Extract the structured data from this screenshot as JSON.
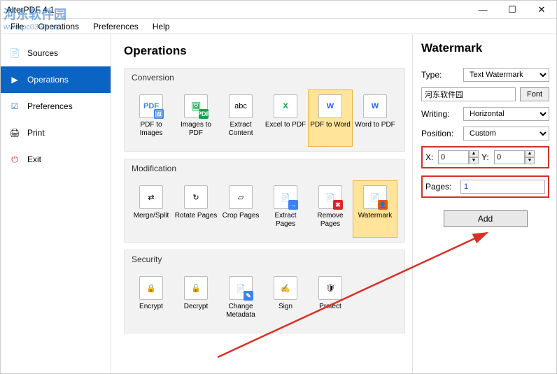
{
  "window": {
    "title": "AlterPDF 4.1"
  },
  "watermark_logo": {
    "text": "河东软件园",
    "url": "www.pc0359.cn"
  },
  "menu": {
    "file": "File",
    "operations": "Operations",
    "preferences": "Preferences",
    "help": "Help"
  },
  "winbtns": {
    "min": "—",
    "max": "☐",
    "close": "✕"
  },
  "sidebar": {
    "items": [
      {
        "label": "Sources",
        "icon": "📄"
      },
      {
        "label": "Operations",
        "icon": "▶"
      },
      {
        "label": "Preferences",
        "icon": "☑"
      },
      {
        "label": "Print",
        "icon": "🖨"
      },
      {
        "label": "Exit",
        "icon": "⏻"
      }
    ]
  },
  "main": {
    "title": "Operations",
    "groups": [
      {
        "title": "Conversion",
        "tools": [
          {
            "label": "PDF to Images",
            "glyph": "PDF",
            "badge": "🖼",
            "bcolor": "#3b82f6"
          },
          {
            "label": "Images to PDF",
            "glyph": "🖼",
            "badge": "PDF",
            "bcolor": "#16a34a"
          },
          {
            "label": "Extract Content",
            "glyph": "abc",
            "badge": "",
            "bcolor": ""
          },
          {
            "label": "Excel to PDF",
            "glyph": "X",
            "badge": "",
            "bcolor": "#16a34a"
          },
          {
            "label": "PDF to Word",
            "glyph": "W",
            "badge": "",
            "bcolor": "#2563eb",
            "active": true
          },
          {
            "label": "Word to PDF",
            "glyph": "W",
            "badge": "",
            "bcolor": "#2563eb"
          }
        ]
      },
      {
        "title": "Modification",
        "tools": [
          {
            "label": "Merge/Split",
            "glyph": "⇄",
            "badge": "",
            "bcolor": ""
          },
          {
            "label": "Rotate Pages",
            "glyph": "↻",
            "badge": "",
            "bcolor": ""
          },
          {
            "label": "Crop Pages",
            "glyph": "▱",
            "badge": "",
            "bcolor": ""
          },
          {
            "label": "Extract Pages",
            "glyph": "📄",
            "badge": "→",
            "bcolor": "#3b82f6"
          },
          {
            "label": "Remove Pages",
            "glyph": "📄",
            "badge": "✖",
            "bcolor": "#dc2626"
          },
          {
            "label": "Watermark",
            "glyph": "📄",
            "badge": "👤",
            "bcolor": "#ea580c",
            "active": true
          }
        ]
      },
      {
        "title": "Security",
        "tools": [
          {
            "label": "Encrypt",
            "glyph": "🔒",
            "badge": "",
            "bcolor": ""
          },
          {
            "label": "Decrypt",
            "glyph": "🔓",
            "badge": "",
            "bcolor": ""
          },
          {
            "label": "Change Metadata",
            "glyph": "📄",
            "badge": "✎",
            "bcolor": "#3b82f6"
          },
          {
            "label": "Sign",
            "glyph": "✍",
            "badge": "",
            "bcolor": ""
          },
          {
            "label": "Protect",
            "glyph": "🛡",
            "badge": "",
            "bcolor": ""
          }
        ]
      }
    ]
  },
  "panel": {
    "title": "Watermark",
    "type_label": "Type:",
    "type_value": "Text Watermark",
    "text_value": "河东软件园",
    "font_btn": "Font",
    "writing_label": "Writing:",
    "writing_value": "Horizontal",
    "position_label": "Position:",
    "position_value": "Custom",
    "x_label": "X:",
    "x_value": "0",
    "y_label": "Y:",
    "y_value": "0",
    "pages_label": "Pages:",
    "pages_value": "1",
    "add_btn": "Add"
  }
}
